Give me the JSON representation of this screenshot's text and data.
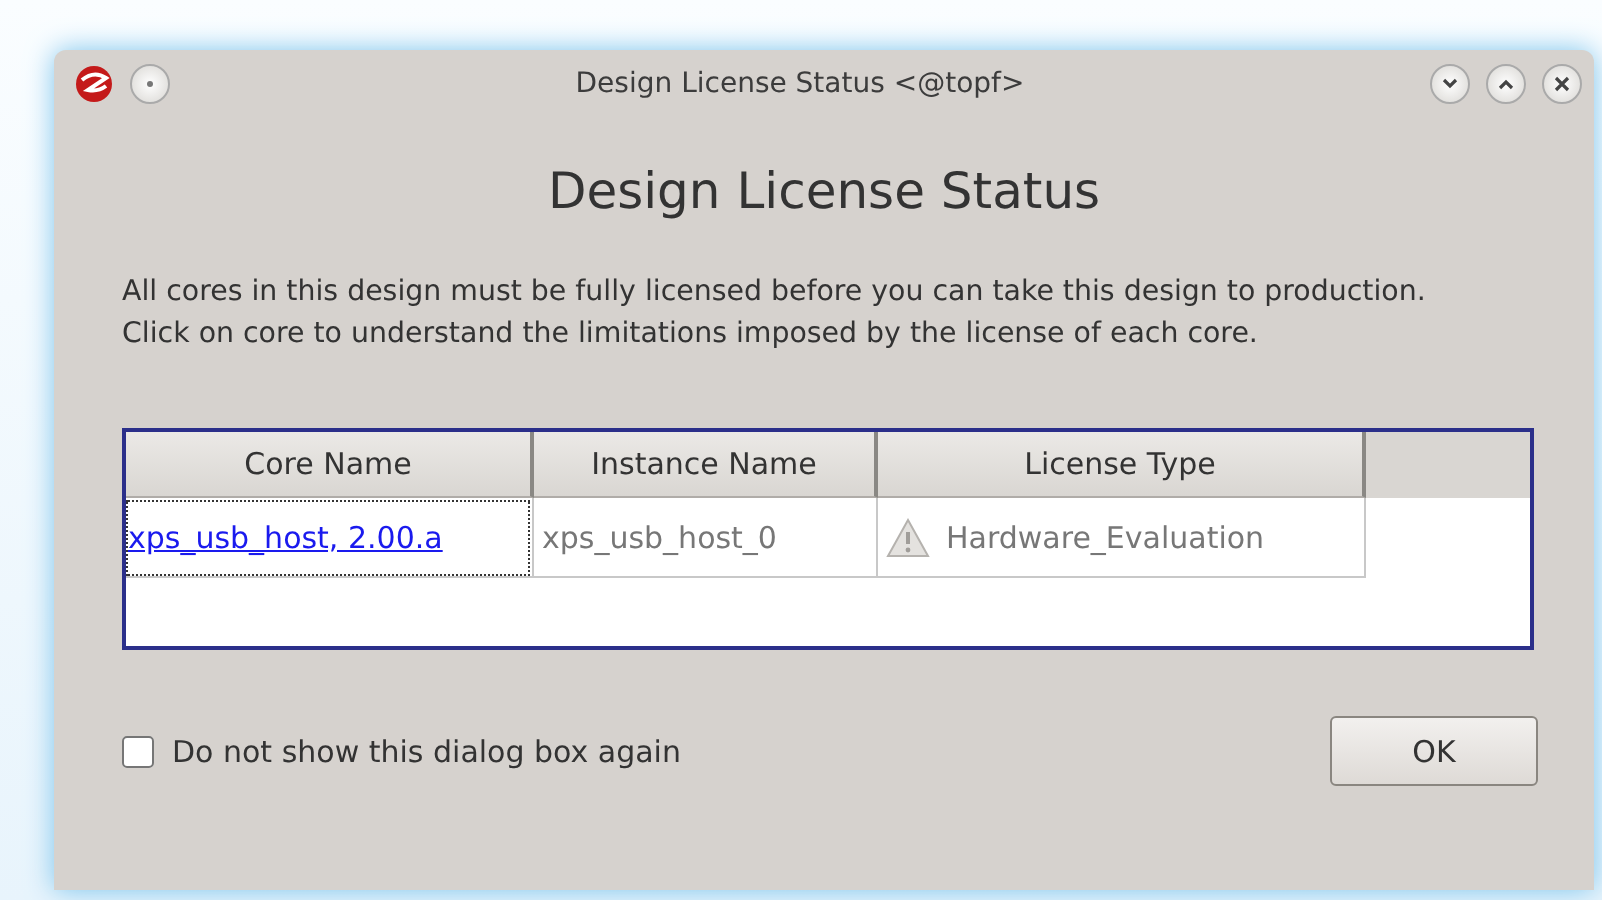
{
  "window": {
    "title": "Design License Status <@topf>"
  },
  "heading": "Design License Status",
  "description": [
    "All cores in this design must be fully licensed before you can take this design to production.",
    "Click on core to understand the limitations imposed by the license of each core."
  ],
  "table": {
    "columns": [
      "Core Name",
      "Instance Name",
      "License Type"
    ],
    "rows": [
      {
        "core": "xps_usb_host, 2.00.a",
        "instance": "xps_usb_host_0",
        "license": "Hardware_Evaluation",
        "warning": true
      }
    ]
  },
  "dont_show_again": {
    "label": "Do not show this dialog box again",
    "checked": false
  },
  "buttons": [
    "OK"
  ]
}
